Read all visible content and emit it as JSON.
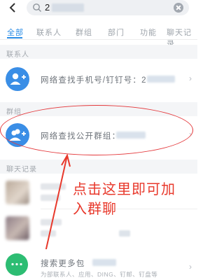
{
  "search": {
    "query": "2"
  },
  "tabs": [
    {
      "label": "全部",
      "active": true
    },
    {
      "label": "联系人"
    },
    {
      "label": "群组"
    },
    {
      "label": "部门"
    },
    {
      "label": "功能"
    },
    {
      "label": "聊天记录"
    }
  ],
  "sections": {
    "contacts": "联系人",
    "groups": "群组",
    "chat": "聊天记录"
  },
  "rows": {
    "find_phone": "网络查找手机号/钉钉号：2",
    "find_group": "网络查找公开群组：",
    "search_more": "搜索更多包",
    "search_more_sub": "为部联系人、应用、DING、钉邮、钉盘等"
  },
  "annotation": {
    "line1": "点击这里即可加",
    "line2": "入群聊"
  },
  "colors": {
    "accent": "#2b8ce5",
    "annotation": "#e8382b",
    "green": "#2dbd73"
  }
}
